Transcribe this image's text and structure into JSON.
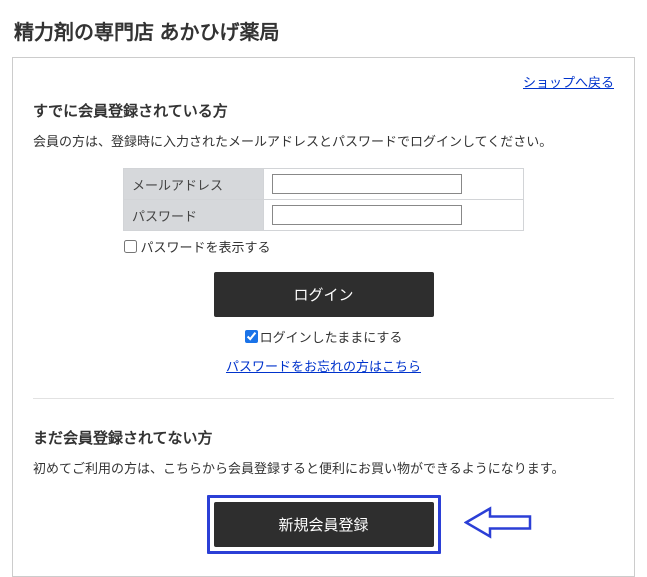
{
  "page_title": "精力剤の専門店 あかひげ薬局",
  "back_link": "ショップへ戻る",
  "login_section": {
    "heading": "すでに会員登録されている方",
    "description": "会員の方は、登録時に入力されたメールアドレスとパスワードでログインしてください。",
    "email_label": "メールアドレス",
    "password_label": "パスワード",
    "show_password_label": "パスワードを表示する",
    "login_button": "ログイン",
    "keep_login_label": "ログインしたままにする",
    "forgot_link": "パスワードをお忘れの方はこちら"
  },
  "register_section": {
    "heading": "まだ会員登録されてない方",
    "description": "初めてご利用の方は、こちらから会員登録すると便利にお買い物ができるようになります。",
    "register_button": "新規会員登録"
  }
}
